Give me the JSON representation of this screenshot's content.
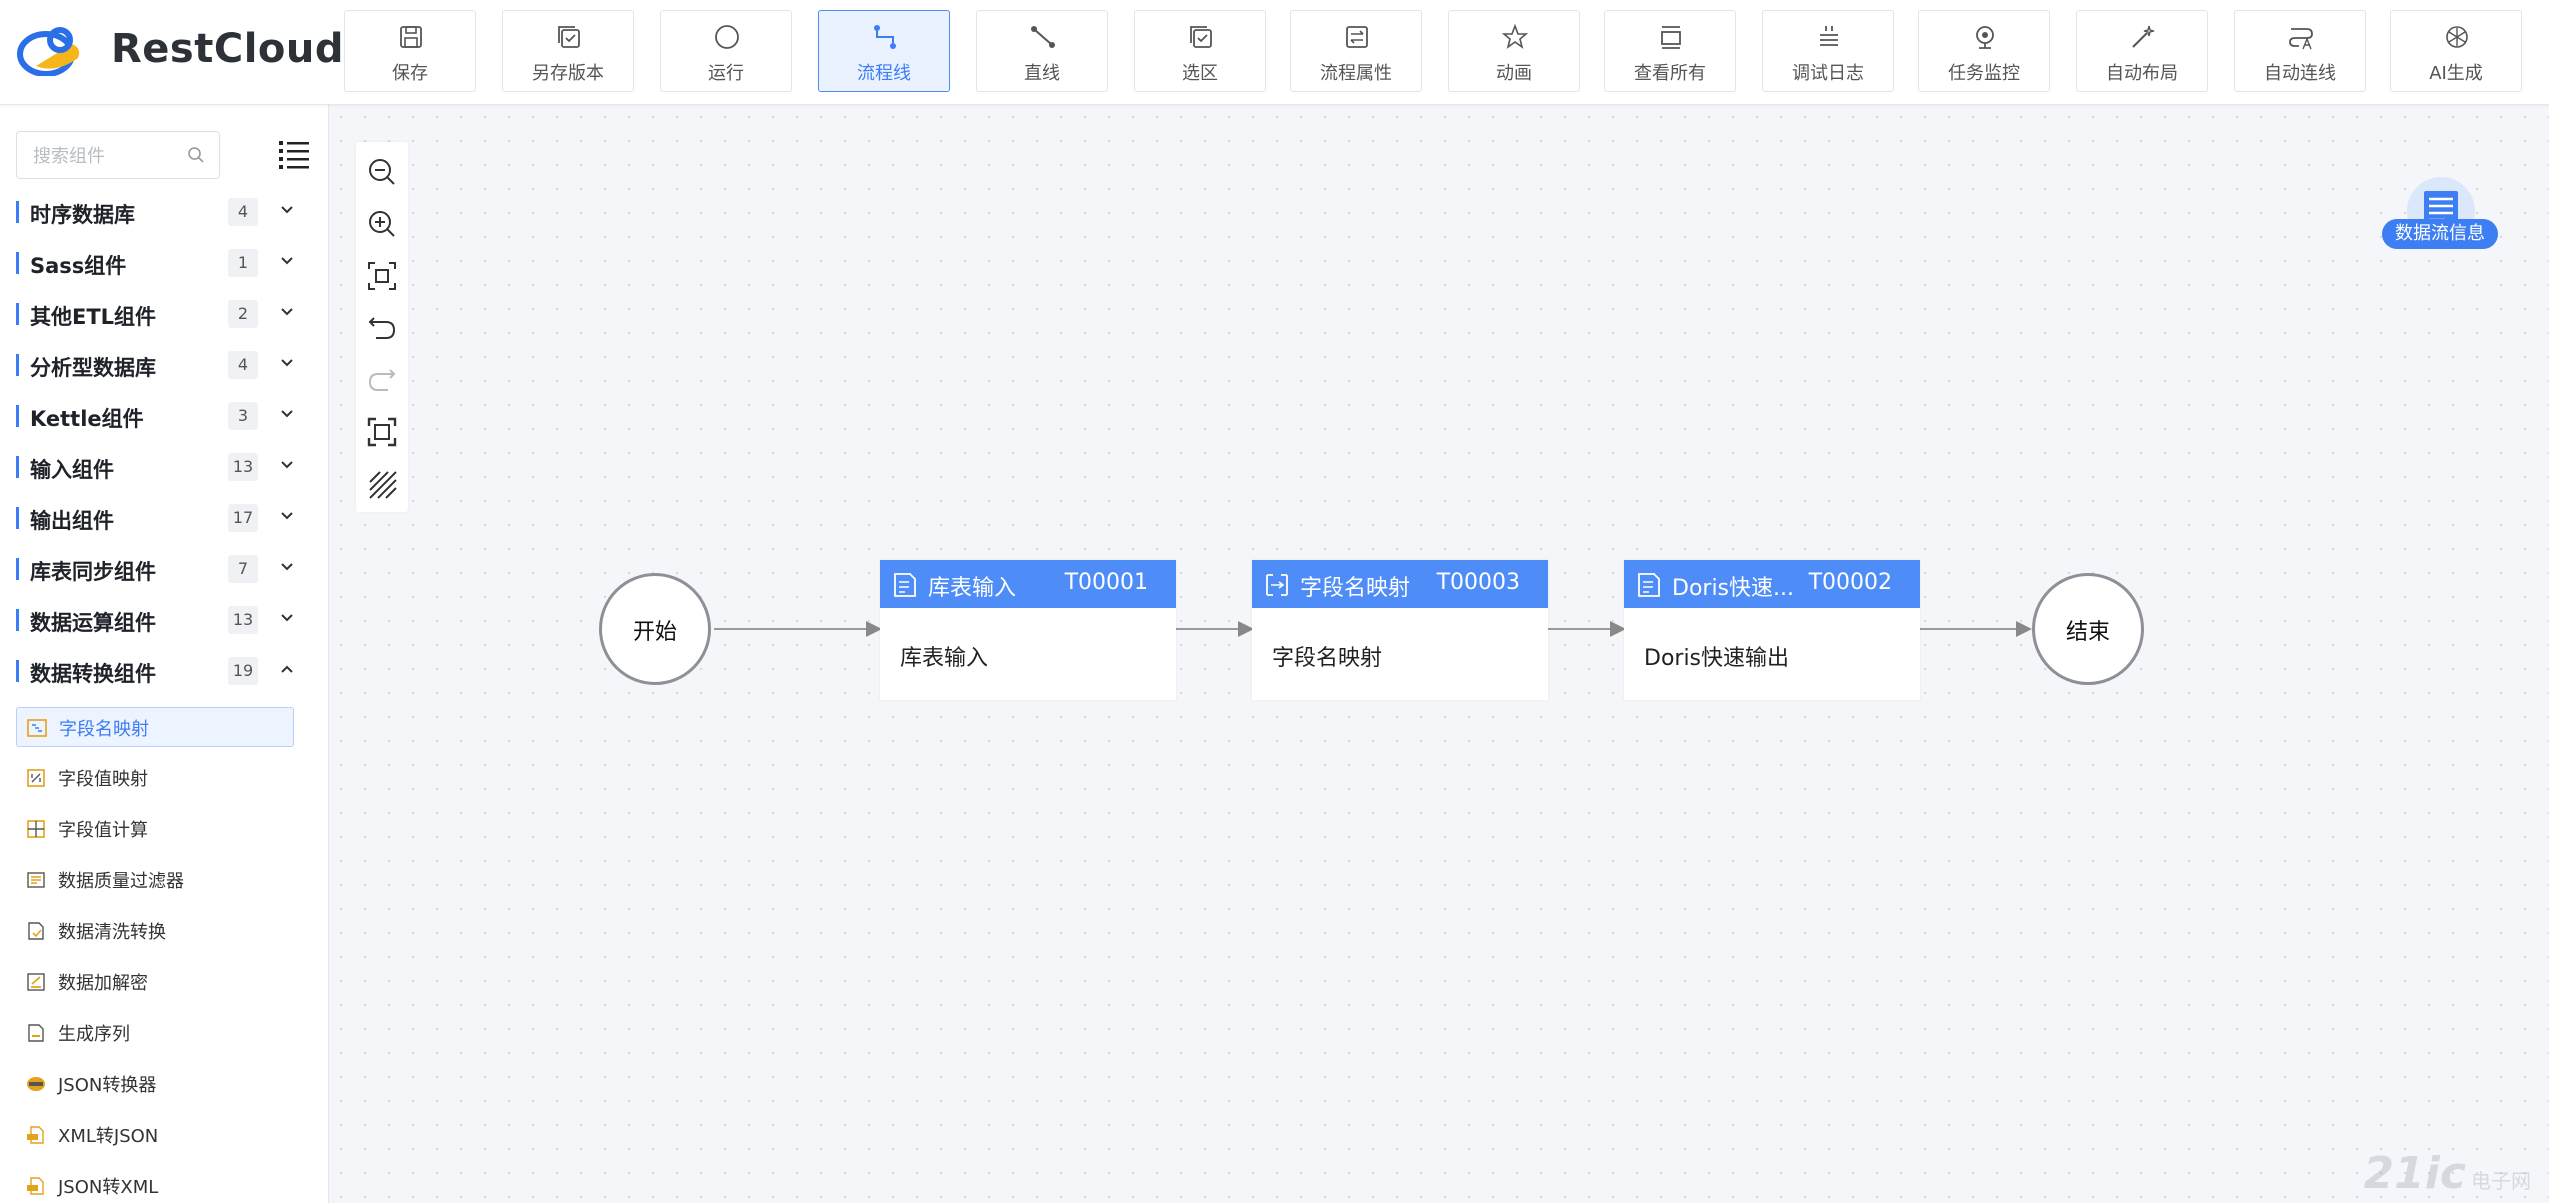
{
  "app": {
    "logo_text": "RestCloud",
    "accent": "#3b7df6",
    "header_color": "#4e8cf7"
  },
  "toolbar": [
    {
      "label": "保存",
      "icon": "save-icon"
    },
    {
      "label": "另存版本",
      "icon": "save-version-icon"
    },
    {
      "label": "运行",
      "icon": "run-icon"
    },
    {
      "label": "流程线",
      "icon": "flow-line-icon",
      "active": true
    },
    {
      "label": "直线",
      "icon": "straight-line-icon"
    },
    {
      "label": "选区",
      "icon": "selection-icon"
    },
    {
      "label": "流程属性",
      "icon": "process-properties-icon"
    },
    {
      "label": "动画",
      "icon": "animation-icon"
    },
    {
      "label": "查看所有",
      "icon": "view-all-icon"
    },
    {
      "label": "调试日志",
      "icon": "debug-log-icon"
    },
    {
      "label": "任务监控",
      "icon": "task-monitor-icon"
    },
    {
      "label": "自动布局",
      "icon": "auto-layout-icon"
    },
    {
      "label": "自动连线",
      "icon": "auto-connect-icon"
    },
    {
      "label": "AI生成",
      "icon": "ai-generate-icon"
    }
  ],
  "sidebar": {
    "search_placeholder": "搜索组件",
    "categories": [
      {
        "name": "时序数据库",
        "count": "4"
      },
      {
        "name": "Sass组件",
        "count": "1"
      },
      {
        "name": "其他ETL组件",
        "count": "2"
      },
      {
        "name": "分析型数据库",
        "count": "4"
      },
      {
        "name": "Kettle组件",
        "count": "3"
      },
      {
        "name": "输入组件",
        "count": "13"
      },
      {
        "name": "输出组件",
        "count": "17"
      },
      {
        "name": "库表同步组件",
        "count": "7"
      },
      {
        "name": "数据运算组件",
        "count": "13"
      },
      {
        "name": "数据转换组件",
        "count": "19",
        "expanded": true
      }
    ],
    "items": [
      {
        "label": "字段名映射",
        "selected": true
      },
      {
        "label": "字段值映射"
      },
      {
        "label": "字段值计算"
      },
      {
        "label": "数据质量过滤器"
      },
      {
        "label": "数据清洗转换"
      },
      {
        "label": "数据加解密"
      },
      {
        "label": "生成序列"
      },
      {
        "label": "JSON转换器"
      },
      {
        "label": "XML转JSON"
      },
      {
        "label": "JSON转XML"
      }
    ]
  },
  "canvas": {
    "start_label": "开始",
    "end_label": "结束",
    "tasks": [
      {
        "title": "库表输入",
        "id": "T00001",
        "body": "库表输入"
      },
      {
        "title": "字段名映射",
        "id": "T00003",
        "body": "字段名映射"
      },
      {
        "title": "Doris快速...",
        "id": "T00002",
        "body": "Doris快速输出"
      }
    ],
    "dataflow_label": "数据流信息"
  },
  "watermark": {
    "main": "21ic",
    "sub": "电子网"
  }
}
